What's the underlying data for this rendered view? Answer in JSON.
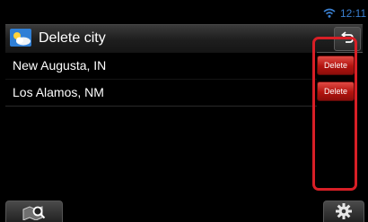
{
  "status_bar": {
    "time": "12:11",
    "wifi_icon": "wifi-icon"
  },
  "header": {
    "title": "Delete city",
    "app_icon": "weather-icon",
    "back_icon": "back-arrow-icon"
  },
  "cities": [
    {
      "name": "New Augusta, IN",
      "action_label": "Delete"
    },
    {
      "name": "Los Alamos, NM",
      "action_label": "Delete"
    }
  ],
  "footer": {
    "left_icon": "map-search-icon",
    "right_icon": "gear-icon"
  },
  "colors": {
    "delete_button": "#c0201b",
    "highlight_frame": "#d81f26",
    "clock": "#3a7fd0"
  }
}
